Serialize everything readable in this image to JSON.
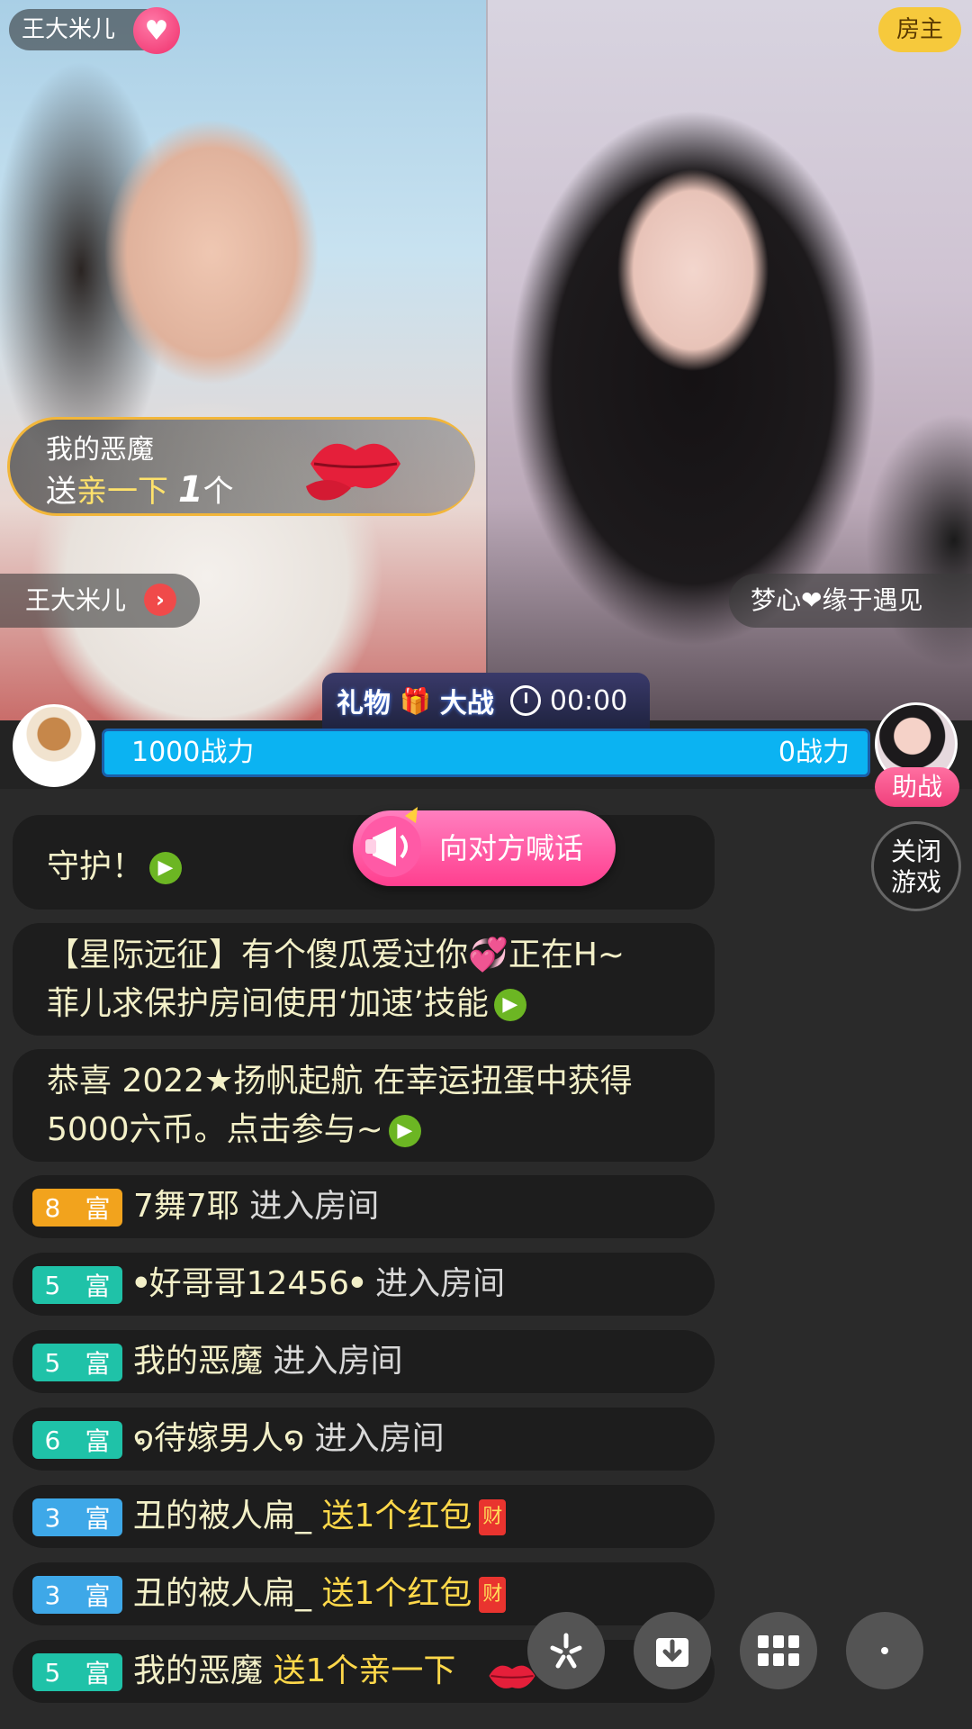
{
  "left_stream": {
    "streamer_name": "王大米儿",
    "follow_icon": "heart-plus-icon",
    "gift_popup": {
      "sender": "我的恶魔",
      "send_word": "送",
      "gift_name": "亲一下",
      "count": "1",
      "unit": "个"
    },
    "name_tag": "王大米儿"
  },
  "right_stream": {
    "host_badge": "房主",
    "name_tag": "梦心❤缘于遇见"
  },
  "battle": {
    "title_a": "礼物",
    "title_b": "大战",
    "timer": "00:00",
    "left_power": "1000战力",
    "right_power": "0战力",
    "left_share": 1.0,
    "assist_label": "助战",
    "close_game_line1": "关闭",
    "close_game_line2": "游戏",
    "shout_label": "向对方喊话",
    "bar_color": "#0bb3f2"
  },
  "chat": {
    "partial_line": "守护！",
    "messages": [
      {
        "line1": "【星际远征】有个傻瓜爱过你",
        "heart": "💞",
        "line1b": "正在H~",
        "line2": "菲儿求保护房间使用‘加速’技能"
      },
      {
        "line1": "恭喜 2022★扬帆起航 在幸运扭蛋中获得",
        "line2": "5000六币。点击参与~"
      }
    ],
    "rows": [
      {
        "level": "8",
        "rich": "富",
        "color": "#f2a31d",
        "name": "7舞7耶",
        "action": "进入房间",
        "gift": ""
      },
      {
        "level": "5",
        "rich": "富",
        "color": "#1fc2a8",
        "name": "ꔷ好哥哥12456ꔷ",
        "action": "进入房间",
        "gift": ""
      },
      {
        "level": "5",
        "rich": "富",
        "color": "#1fc2a8",
        "name": "我的恶魔",
        "action": "进入房间",
        "gift": ""
      },
      {
        "level": "6",
        "rich": "富",
        "color": "#1fc2a8",
        "name": "໑待嫁男人໑",
        "action": "进入房间",
        "gift": ""
      },
      {
        "level": "3",
        "rich": "富",
        "color": "#3ea8e8",
        "name": "丑的被人扁_",
        "action": "",
        "gift": "送1个红包"
      },
      {
        "level": "3",
        "rich": "富",
        "color": "#3ea8e8",
        "name": "丑的被人扁_",
        "action": "",
        "gift": "送1个红包"
      },
      {
        "level": "5",
        "rich": "富",
        "color": "#1fc2a8",
        "name": "我的恶魔",
        "action": "",
        "gift": "送1个亲一下"
      }
    ],
    "redpack_glyph": "财"
  },
  "toolbar": {
    "icons": [
      "sparkle-icon",
      "download-icon",
      "grid-icon",
      "more-icon"
    ]
  }
}
